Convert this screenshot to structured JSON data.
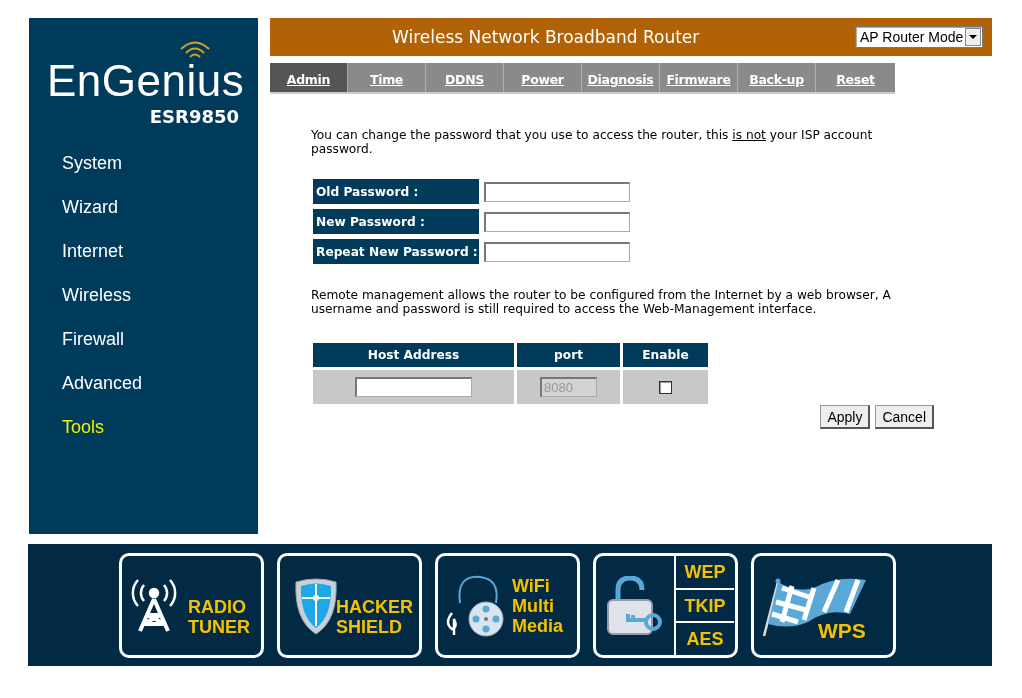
{
  "brand": {
    "logo": "EnGenius",
    "model": "ESR9850"
  },
  "sidebar": {
    "items": [
      {
        "label": "System",
        "selected": false
      },
      {
        "label": "Wizard",
        "selected": false
      },
      {
        "label": "Internet",
        "selected": false
      },
      {
        "label": "Wireless",
        "selected": false
      },
      {
        "label": "Firewall",
        "selected": false
      },
      {
        "label": "Advanced",
        "selected": false
      },
      {
        "label": "Tools",
        "selected": true
      }
    ]
  },
  "header": {
    "title": "Wireless Network Broadband Router",
    "mode_select": {
      "value": "AP Router Mode"
    }
  },
  "tabs": [
    {
      "label": "Admin",
      "selected": true
    },
    {
      "label": "Time",
      "selected": false
    },
    {
      "label": "DDNS",
      "selected": false
    },
    {
      "label": "Power",
      "selected": false
    },
    {
      "label": "Diagnosis",
      "selected": false
    },
    {
      "label": "Firmware",
      "selected": false
    },
    {
      "label": "Back-up",
      "selected": false
    },
    {
      "label": "Reset",
      "selected": false
    }
  ],
  "intro": {
    "before": "You can change the password that you use to access the router, this",
    "underlined": "is not",
    "after": "your ISP account password."
  },
  "password_fields": [
    {
      "label": "Old Password :"
    },
    {
      "label": "New Password :"
    },
    {
      "label": "Repeat New Password :"
    }
  ],
  "remote_note": "Remote management allows the router to be configured from the Internet by a web browser, A username and password is still required to access the Web-Management interface.",
  "remote_table": {
    "columns": [
      "Host Address",
      "port",
      "Enable"
    ],
    "port": {
      "value": "8080",
      "disabled": true
    },
    "enable": {
      "checked": false
    }
  },
  "buttons": [
    "Apply",
    "Cancel"
  ],
  "features": [
    {
      "kind": "radio",
      "lines": [
        "RADIO",
        "TUNER"
      ]
    },
    {
      "kind": "shield",
      "lines": [
        "HACKER",
        "SHIELD"
      ]
    },
    {
      "kind": "media",
      "lines": [
        "WiFi",
        "Multi",
        "Media"
      ]
    },
    {
      "kind": "security",
      "lines": [
        "WEP",
        "TKIP",
        "AES"
      ]
    },
    {
      "kind": "flag",
      "lines": [
        "WPS"
      ]
    }
  ]
}
